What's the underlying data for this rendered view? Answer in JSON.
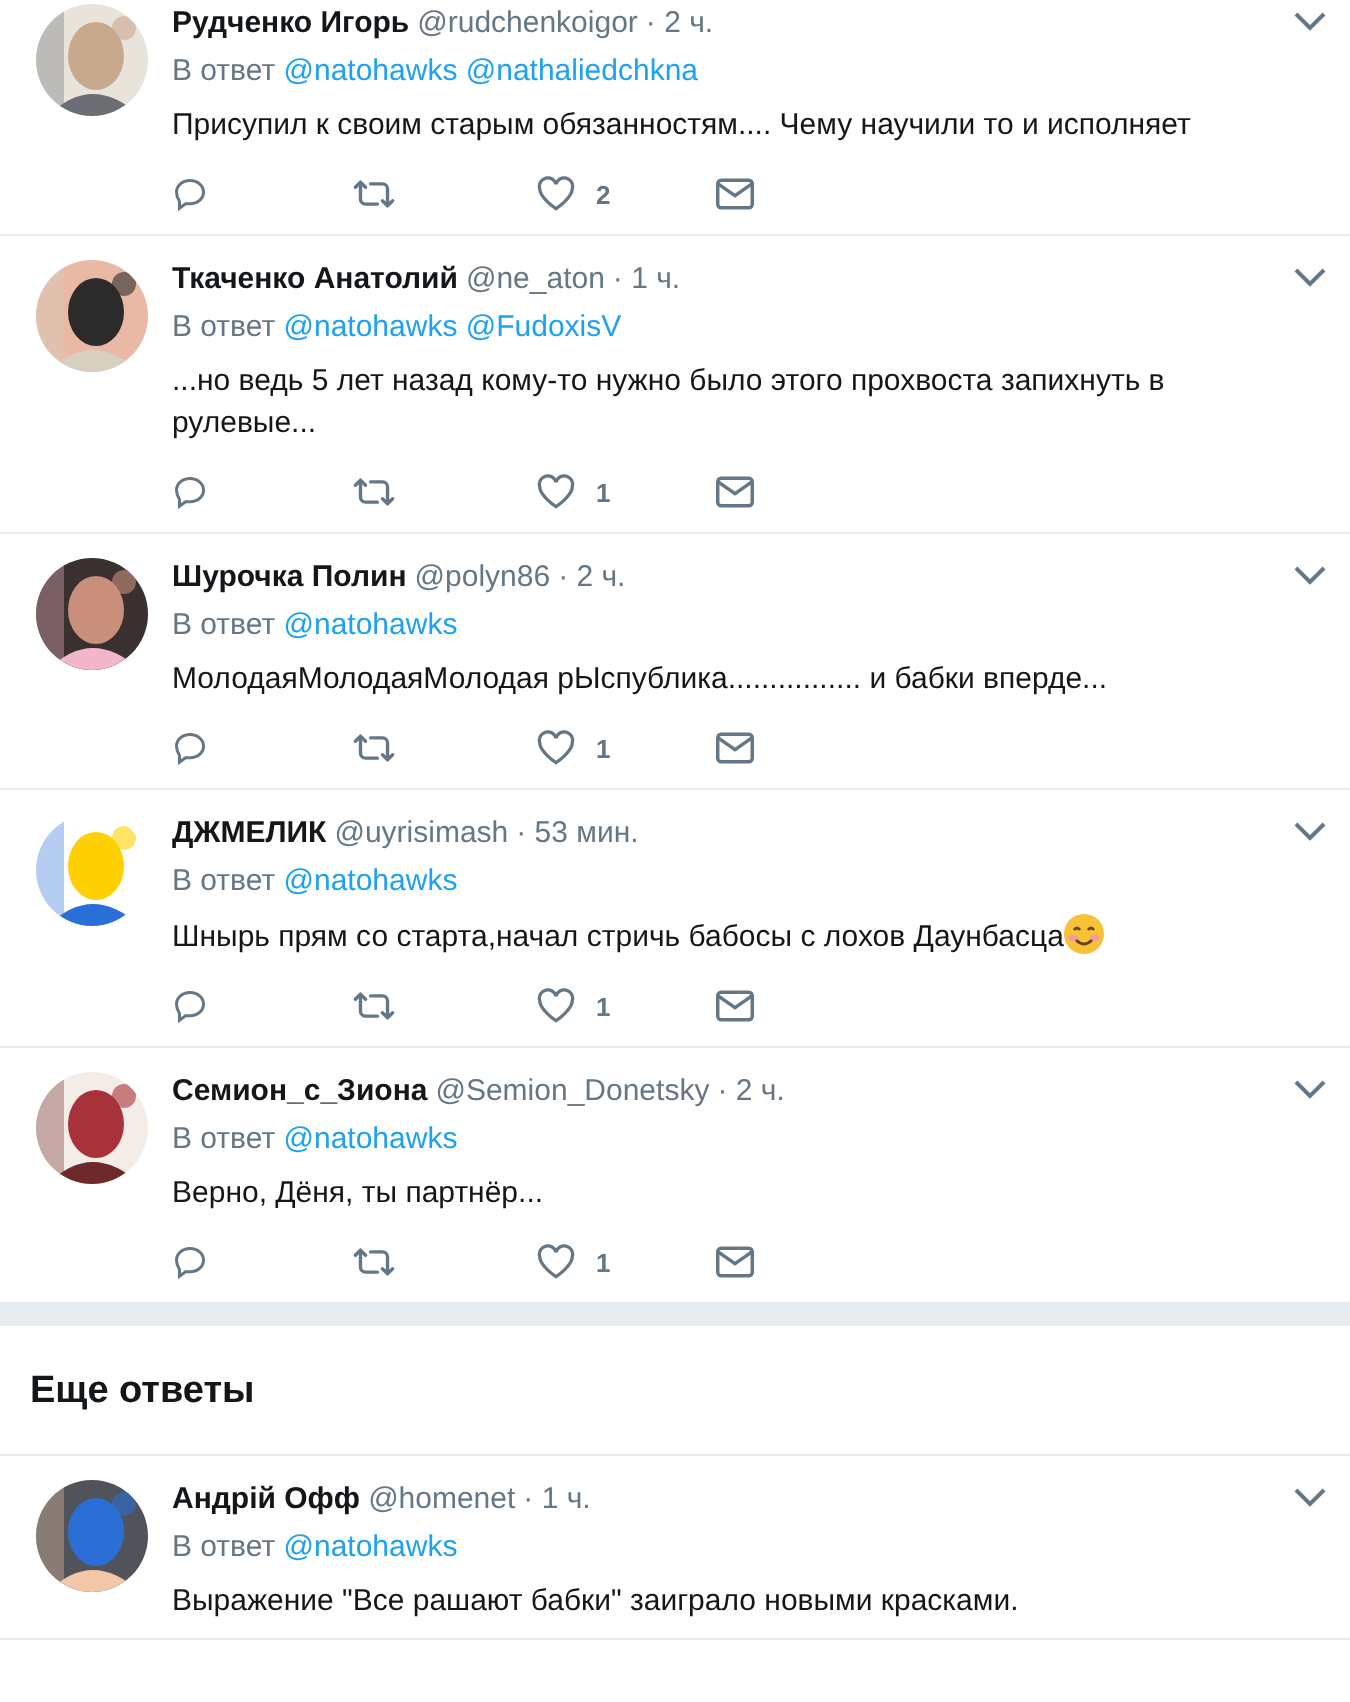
{
  "replies": [
    {
      "name": "Рудченко Игорь",
      "handle": "@rudchenkoigor",
      "time": "· 2 ч.",
      "reply_prefix": "В ответ",
      "mentions": [
        "@natohawks",
        "@nathaliedchkna"
      ],
      "text": "Присупил к своим старым обязанностям.... Чему научили то и исполняет",
      "likes": "2",
      "emoji": false
    },
    {
      "name": "Ткаченко Анатолий",
      "handle": "@ne_aton",
      "time": "· 1 ч.",
      "reply_prefix": "В ответ",
      "mentions": [
        "@natohawks",
        "@FudoxisV"
      ],
      "text": "...но ведь 5 лет назад кому-то нужно было этого прохвоста запихнуть в рулевые...",
      "likes": "1",
      "emoji": false
    },
    {
      "name": "Шурочка Полин",
      "handle": "@polyn86",
      "time": "· 2 ч.",
      "reply_prefix": "В ответ",
      "mentions": [
        "@natohawks"
      ],
      "text": "МолодаяМолодаяМолодая рЫспублика................ и бабки вперде...",
      "likes": "1",
      "emoji": false
    },
    {
      "name": "ДЖМЕЛИК",
      "handle": "@uyrisimash",
      "time": "· 53 мин.",
      "reply_prefix": "В ответ",
      "mentions": [
        "@natohawks"
      ],
      "text": "Шнырь прям со старта,начал стричь бабосы с лохов Даунбасца",
      "likes": "1",
      "emoji": true
    },
    {
      "name": "Семион_с_Зиона",
      "handle": "@Semion_Donetsky",
      "time": "· 2 ч.",
      "reply_prefix": "В ответ",
      "mentions": [
        "@natohawks"
      ],
      "text": "Верно, Дёня, ты партнёр...",
      "likes": "1",
      "emoji": false
    }
  ],
  "more_replies": {
    "title": "Еще ответы",
    "replies": [
      {
        "name": "Андрій Офф",
        "handle": "@homenet",
        "time": "· 1 ч.",
        "reply_prefix": "В ответ",
        "mentions": [
          "@natohawks"
        ],
        "text": "Выражение \"Все рашают бабки\" заиграло новыми красками.",
        "emoji": false
      }
    ]
  }
}
